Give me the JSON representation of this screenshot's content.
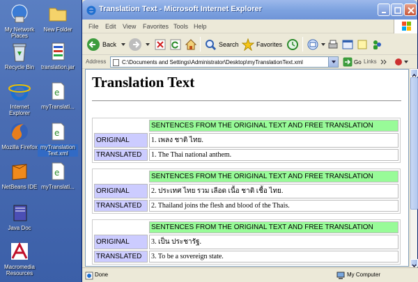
{
  "desktop": {
    "icons": [
      {
        "label": "My Network Places"
      },
      {
        "label": "New Folder"
      },
      {
        "label": "Recycle Bin"
      },
      {
        "label": "translation.jar"
      },
      {
        "label": "Internet Explorer"
      },
      {
        "label": "myTranslati..."
      },
      {
        "label": "Mozilla Firefox"
      },
      {
        "label": "myTranslation Text.xml"
      },
      {
        "label": "NetBeans IDE"
      },
      {
        "label": "myTranslati..."
      },
      {
        "label": "Java Doc"
      },
      {
        "label": "Macromedia Resources"
      }
    ]
  },
  "window": {
    "title": "Translation Text - Microsoft Internet Explorer",
    "menu": [
      "File",
      "Edit",
      "View",
      "Favorites",
      "Tools",
      "Help"
    ],
    "toolbar": {
      "back_label": "Back",
      "search_label": "Search",
      "favorites_label": "Favorites"
    },
    "address": {
      "label": "Address",
      "value": "C:\\Documents and Settings\\Administrator\\Desktop\\myTranslationText.xml",
      "go_label": "Go",
      "links_label": "Links"
    },
    "status": {
      "text": "Done",
      "zone": "My Computer"
    }
  },
  "page": {
    "title": "Translation Text",
    "header_label": "SENTENCES FROM THE ORIGINAL TEXT AND FREE TRANSLATION",
    "original_label": "ORIGINAL",
    "translated_label": "TRANSLATED",
    "entries": [
      {
        "original": "1. เพลง ชาติ ไทย.",
        "translated": "1. The Thai national anthem."
      },
      {
        "original": "2. ประเทศ ไทย รวม เลือด เนื้อ ชาติ เชื้อ ไทย.",
        "translated": "2. Thailand joins the flesh and blood of the Thais."
      },
      {
        "original": "3. เป็น ประชารัฐ.",
        "translated": "3. To be a sovereign state."
      }
    ]
  }
}
